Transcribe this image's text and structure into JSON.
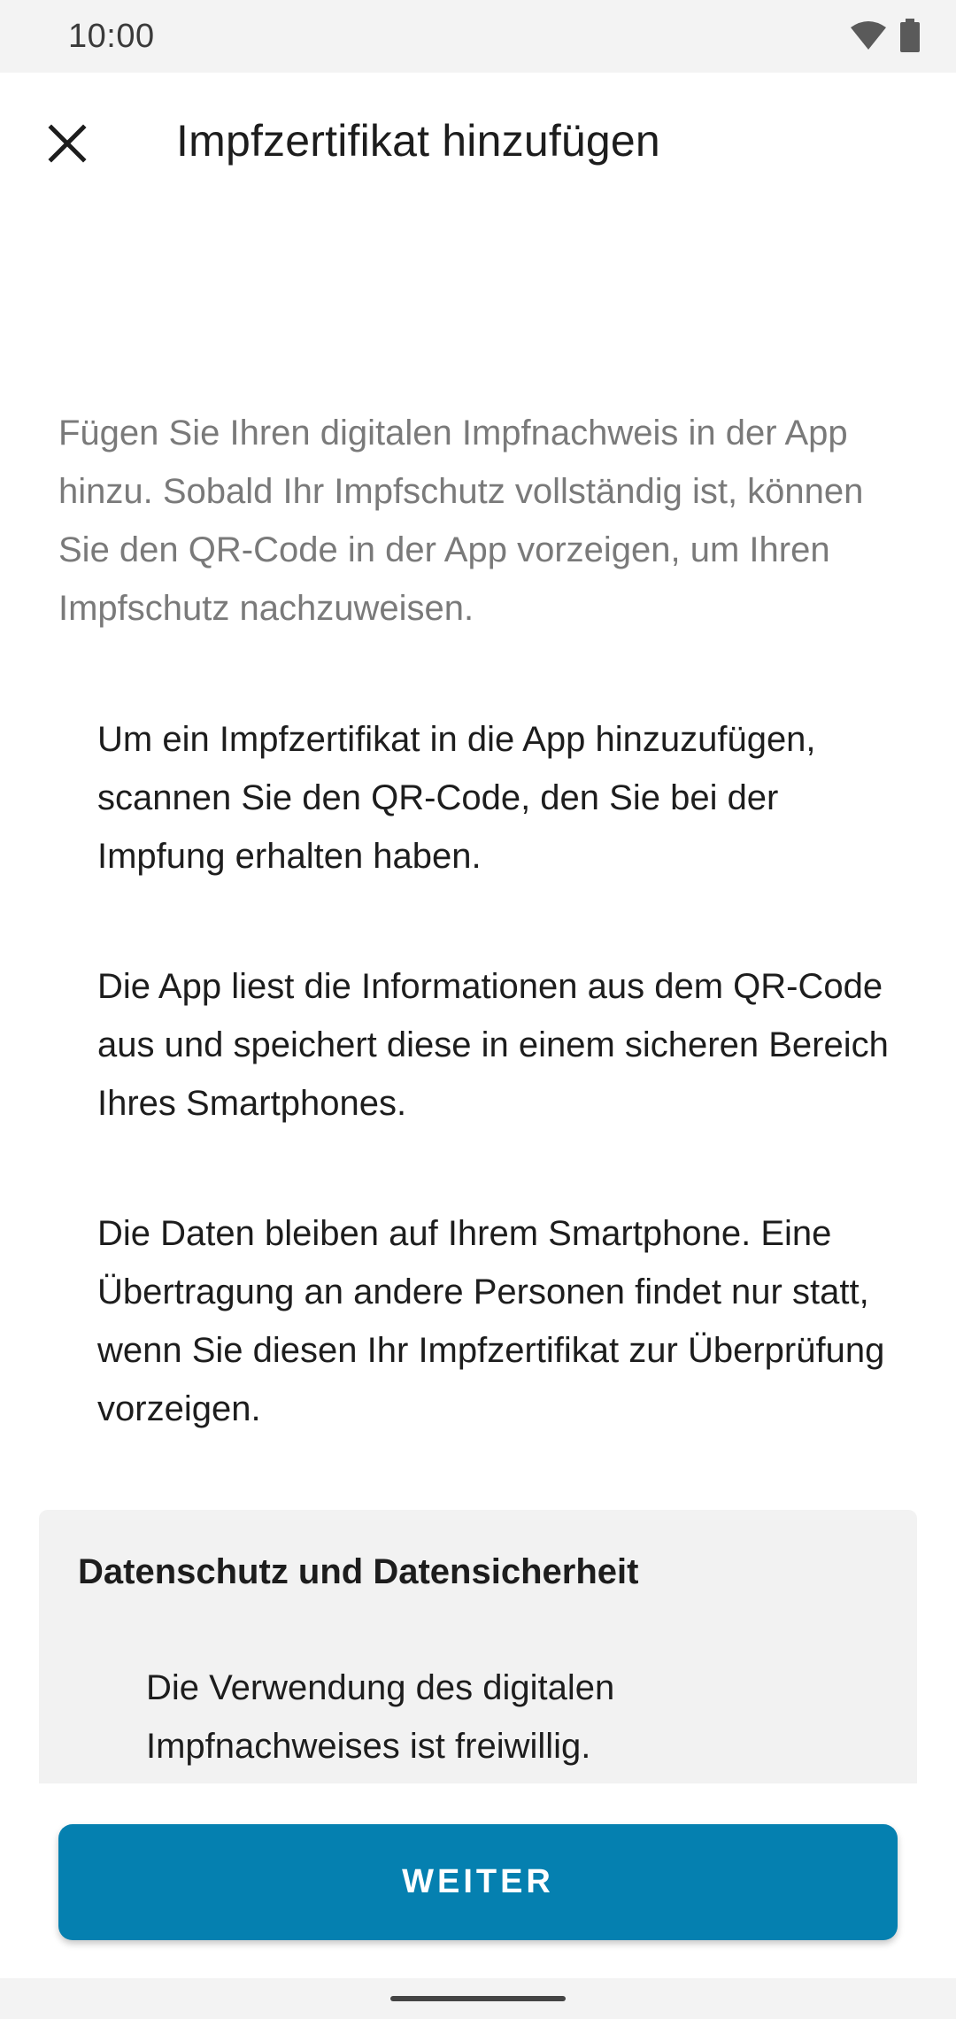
{
  "status_bar": {
    "time": "10:00",
    "icons": [
      "wifi-icon",
      "battery-icon"
    ]
  },
  "app_bar": {
    "close_icon": "close-icon",
    "title": "Impfzertifikat hinzufügen"
  },
  "intro": "Fügen Sie Ihren digitalen Impfnachweis in der App hinzu. Sobald Ihr Impfschutz vollständig ist, können Sie den QR-Code in der App vorzeigen, um Ihren Impfschutz nachzuweisen.",
  "info_items": [
    "Um ein Impfzertifikat in die App hinzuzufügen, scannen Sie den QR-Code, den Sie bei der Impfung erhalten haben.",
    "Die App liest die Informationen aus dem QR-Code aus und speichert diese in einem sicheren Bereich Ihres Smartphones.",
    "Die Daten bleiben auf Ihrem Smartphone. Eine Übertragung an andere Personen findet nur statt, wenn Sie diesen Ihr Impfzertifikat zur Überprüfung vorzeigen."
  ],
  "privacy": {
    "title": "Datenschutz und Datensicherheit",
    "items": [
      "Die Verwendung des digitalen Impfnachweises ist freiwillig."
    ]
  },
  "primary_button": "WEITER",
  "colors": {
    "accent": "#0580b0",
    "intro_text": "#7a7a7a",
    "privacy_bg": "#f2f2f2"
  }
}
